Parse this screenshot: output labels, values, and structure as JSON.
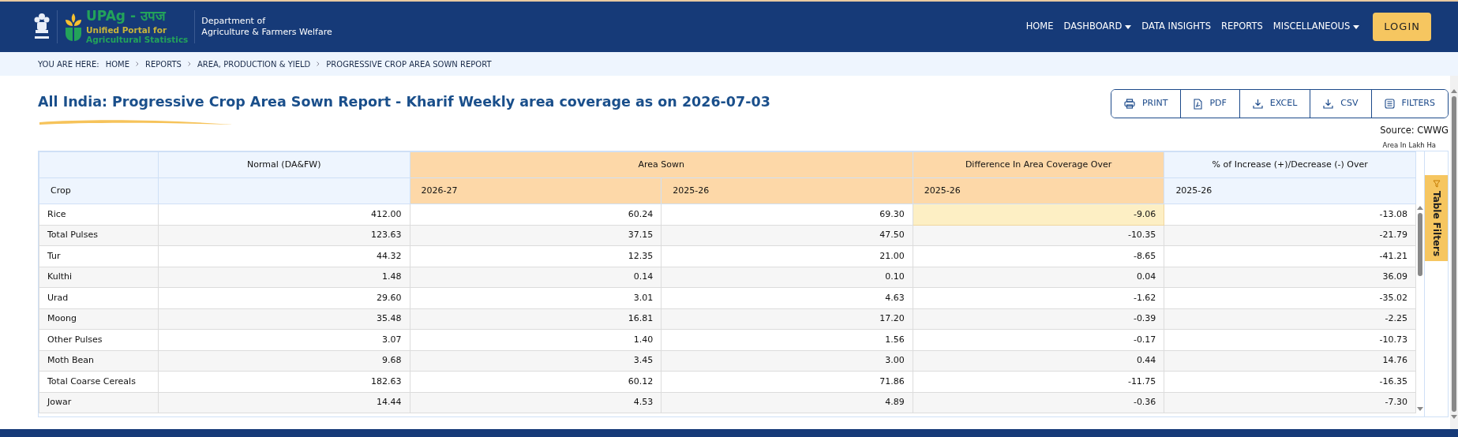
{
  "header": {
    "brand": "UPAg - उपज",
    "brand_line_1": "Unified Portal for",
    "brand_line_2": "Agricultural Statistics",
    "department_line_1": "Department of",
    "department_line_2": "Agriculture & Farmers Welfare"
  },
  "nav": [
    {
      "label": "HOME",
      "dropdown": false
    },
    {
      "label": "DASHBOARD",
      "dropdown": true
    },
    {
      "label": "DATA INSIGHTS",
      "dropdown": false
    },
    {
      "label": "REPORTS",
      "dropdown": false
    },
    {
      "label": "MISCELLANEOUS",
      "dropdown": true
    }
  ],
  "login": "LOGIN",
  "breadcrumb": {
    "prefix": "YOU ARE HERE:",
    "items": [
      "HOME",
      "REPORTS",
      "AREA, PRODUCTION & YIELD",
      "PROGRESSIVE CROP AREA SOWN REPORT"
    ]
  },
  "title": "All India: Progressive Crop Area Sown Report - Kharif Weekly area coverage as on 2026-07-03",
  "toolbar": [
    {
      "label": "PRINT",
      "kind": "print"
    },
    {
      "label": "PDF",
      "kind": "pdf"
    },
    {
      "label": "EXCEL",
      "kind": "download"
    },
    {
      "label": "CSV",
      "kind": "download"
    },
    {
      "label": "FILTERS",
      "kind": "filters"
    }
  ],
  "source": "Source: CWWG",
  "unit": "Area In Lakh Ha",
  "table": {
    "first_column": "Crop",
    "groups": [
      {
        "label": "Normal (DA&FW)",
        "color": "#eef5fe"
      },
      {
        "label": "Area Sown",
        "color": "#fdd8a8",
        "subheaders": [
          "2026-27",
          "2025-26"
        ]
      },
      {
        "label": "Difference In Area Coverage Over",
        "color": "#fdd8a8",
        "subheaders": [
          "2025-26"
        ]
      },
      {
        "label": "% of Increase (+)/Decrease (-) Over",
        "color": "#eef5fe",
        "subheaders": [
          "2025-26"
        ]
      }
    ],
    "rows": [
      {
        "crop": "Rice",
        "values": [
          "412.00",
          "60.24",
          "69.30",
          "-9.06",
          "-13.08"
        ],
        "highlighted": [
          false,
          false,
          false,
          true,
          false
        ]
      },
      {
        "crop": "Total Pulses",
        "values": [
          "123.63",
          "37.15",
          "47.50",
          "-10.35",
          "-21.79"
        ],
        "highlighted": [
          false,
          false,
          false,
          false,
          false
        ]
      },
      {
        "crop": "Tur",
        "values": [
          "44.32",
          "12.35",
          "21.00",
          "-8.65",
          "-41.21"
        ],
        "highlighted": [
          false,
          false,
          false,
          false,
          false
        ]
      },
      {
        "crop": "Kulthi",
        "values": [
          "1.48",
          "0.14",
          "0.10",
          "0.04",
          "36.09"
        ],
        "highlighted": [
          false,
          false,
          false,
          false,
          false
        ]
      },
      {
        "crop": "Urad",
        "values": [
          "29.60",
          "3.01",
          "4.63",
          "-1.62",
          "-35.02"
        ],
        "highlighted": [
          false,
          false,
          false,
          false,
          false
        ]
      },
      {
        "crop": "Moong",
        "values": [
          "35.48",
          "16.81",
          "17.20",
          "-0.39",
          "-2.25"
        ],
        "highlighted": [
          false,
          false,
          false,
          false,
          false
        ]
      },
      {
        "crop": "Other Pulses",
        "values": [
          "3.07",
          "1.40",
          "1.56",
          "-0.17",
          "-10.73"
        ],
        "highlighted": [
          false,
          false,
          false,
          false,
          false
        ]
      },
      {
        "crop": "Moth Bean",
        "values": [
          "9.68",
          "3.45",
          "3.00",
          "0.44",
          "14.76"
        ],
        "highlighted": [
          false,
          false,
          false,
          false,
          false
        ]
      },
      {
        "crop": "Total Coarse Cereals",
        "values": [
          "182.63",
          "60.12",
          "71.86",
          "-11.75",
          "-16.35"
        ],
        "highlighted": [
          false,
          false,
          false,
          false,
          false
        ]
      },
      {
        "crop": "Jowar",
        "values": [
          "14.44",
          "4.53",
          "4.89",
          "-0.36",
          "-7.30"
        ],
        "highlighted": [
          false,
          false,
          false,
          false,
          false
        ]
      }
    ]
  },
  "table_filters": "Table Filters"
}
